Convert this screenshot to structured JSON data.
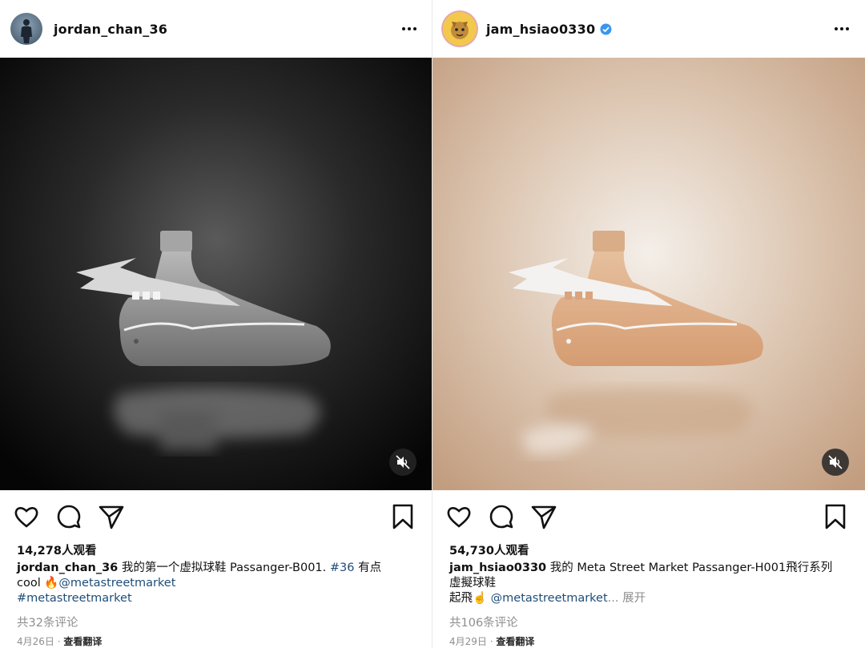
{
  "posts": [
    {
      "username": "jordan_chan_36",
      "verified": false,
      "likes": "14,278人观看",
      "caption": {
        "user": "jordan_chan_36",
        "text": "我的第一个虚拟球鞋 Passanger-B001.",
        "hashtag1": "#36",
        "text2": "有点",
        "line2_text": "cool",
        "emoji": "🔥",
        "mention": "@metastreetmarket",
        "line3_hashtag": "#metastreetmarket"
      },
      "comments": "共32条评论",
      "date": "4月26日",
      "separator": "·",
      "translate": "查看翻译",
      "image_tone": "black",
      "icons": [
        "more-icon",
        "heart-icon",
        "comment-icon",
        "share-icon",
        "bookmark-icon",
        "mute-icon"
      ]
    },
    {
      "username": "jam_hsiao0330",
      "verified": true,
      "likes": "54,730人观看",
      "caption": {
        "user": "jam_hsiao0330",
        "text": "我的 Meta Street Market Passanger-H001飛行系列",
        "line2_text": "虛擬球鞋",
        "line3_text": "起飛",
        "emoji": "☝️",
        "mention": "@metastreetmarket",
        "ellipsis": "...",
        "expand": "展开"
      },
      "comments": "共106条评论",
      "date": "4月29日",
      "separator": "·",
      "translate": "查看翻译",
      "image_tone": "tan",
      "icons": [
        "more-icon",
        "heart-icon",
        "comment-icon",
        "share-icon",
        "bookmark-icon",
        "mute-icon"
      ]
    }
  ],
  "colors": {
    "link": "#1e4d78",
    "muted": "#8e8e8e",
    "verified": "#3897f0",
    "left_bg": "#0c0c0c",
    "right_bg": "#c9a98c"
  }
}
